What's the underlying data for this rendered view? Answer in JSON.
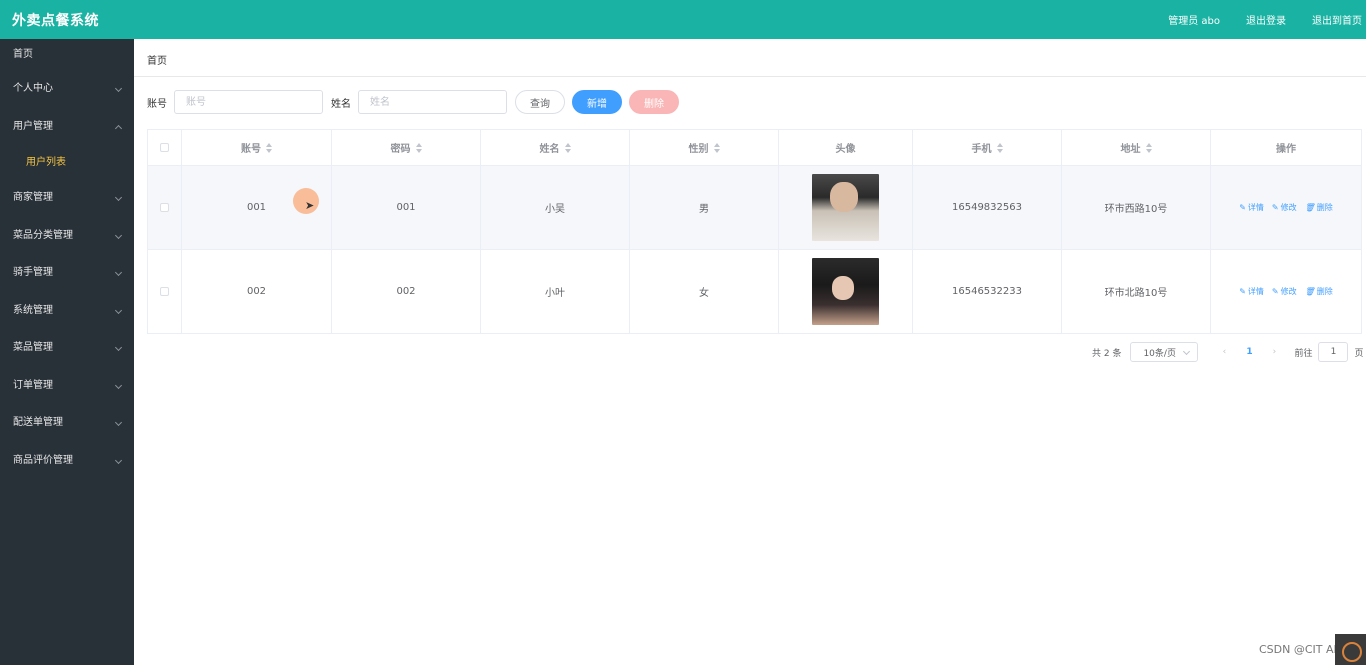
{
  "app": {
    "title": "外卖点餐系统"
  },
  "header": {
    "admin": "管理员 abo",
    "logout": "退出登录",
    "exit_home": "退出到首页"
  },
  "sidebar": {
    "items": [
      {
        "label": "首页"
      },
      {
        "label": "个人中心"
      },
      {
        "label": "用户管理"
      },
      {
        "label": "商家管理"
      },
      {
        "label": "菜品分类管理"
      },
      {
        "label": "骑手管理"
      },
      {
        "label": "系统管理"
      },
      {
        "label": "菜品管理"
      },
      {
        "label": "订单管理"
      },
      {
        "label": "配送单管理"
      },
      {
        "label": "商品评价管理"
      }
    ],
    "sub_active": "用户列表"
  },
  "breadcrumb": "首页",
  "search": {
    "account_label": "账号",
    "account_placeholder": "账号",
    "name_label": "姓名",
    "name_placeholder": "姓名",
    "query": "查询",
    "add": "新增",
    "delete": "删除"
  },
  "table": {
    "columns": [
      "账号",
      "密码",
      "姓名",
      "性别",
      "头像",
      "手机",
      "地址",
      "操作"
    ],
    "rows": [
      {
        "account": "001",
        "password": "001",
        "name": "小吴",
        "gender": "男",
        "phone": "16549832563",
        "address": "环市西路10号"
      },
      {
        "account": "002",
        "password": "002",
        "name": "小叶",
        "gender": "女",
        "phone": "16546532233",
        "address": "环市北路10号"
      }
    ],
    "ops": {
      "detail": "详情",
      "edit": "修改",
      "remove": "删除"
    }
  },
  "pager": {
    "total": "共 2 条",
    "size": "10条/页",
    "current": "1",
    "goto": "前往",
    "jump": "1",
    "page": "页"
  },
  "watermark": "CSDN @CIT ART"
}
